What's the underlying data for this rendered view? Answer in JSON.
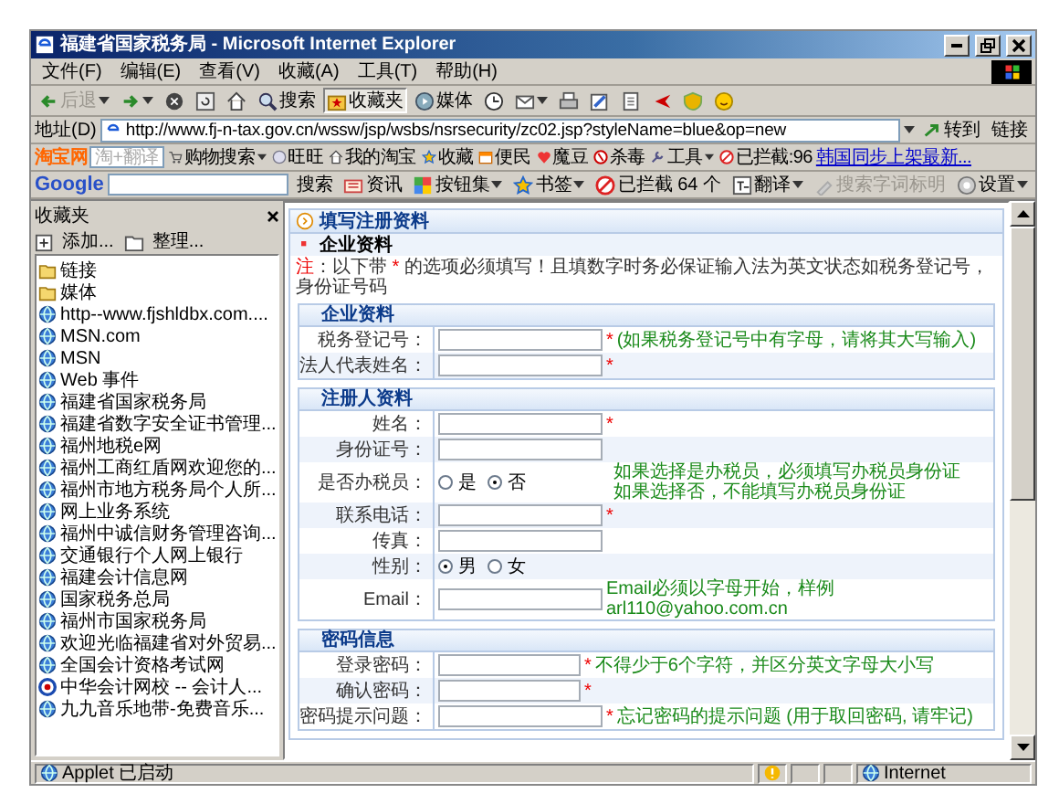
{
  "window": {
    "title": "福建省国家税务局 - Microsoft Internet Explorer"
  },
  "menu": [
    "文件(F)",
    "编辑(E)",
    "查看(V)",
    "收藏(A)",
    "工具(T)",
    "帮助(H)"
  ],
  "toolbar": [
    {
      "kind": "back",
      "label": "后退",
      "disabled": true,
      "dropdown": true
    },
    {
      "kind": "forward",
      "dropdown": true
    },
    {
      "kind": "stop"
    },
    {
      "kind": "refresh"
    },
    {
      "kind": "home"
    },
    {
      "kind": "search",
      "label": "搜索"
    },
    {
      "kind": "favorites",
      "label": "收藏夹",
      "selected": true
    },
    {
      "kind": "media",
      "label": "媒体"
    },
    {
      "kind": "history"
    },
    {
      "kind": "mail",
      "dropdown": true
    },
    {
      "kind": "print"
    },
    {
      "kind": "edit"
    },
    {
      "kind": "document"
    },
    {
      "kind": "arrow"
    },
    {
      "kind": "shield"
    },
    {
      "kind": "smiley"
    }
  ],
  "address": {
    "label": "地址(D)",
    "url": "http://www.fj-n-tax.gov.cn/wssw/jsp/wsbs/nsrsecurity/zc02.jsp?styleName=blue&op=new",
    "go": "转到",
    "links": "链接"
  },
  "taobao_bar": {
    "logo": "淘宝网",
    "placeholder": "淘+翻译",
    "items": [
      {
        "kind": "cart",
        "label": "购物搜索",
        "dropdown": true
      },
      {
        "kind": "chat",
        "label": "旺旺"
      },
      {
        "kind": "home",
        "label": "我的淘宝"
      },
      {
        "kind": "star",
        "label": "收藏"
      },
      {
        "kind": "calendar",
        "label": "便民"
      },
      {
        "kind": "heart",
        "label": "魔豆"
      },
      {
        "kind": "antivirus",
        "label": "杀毒"
      },
      {
        "kind": "tools",
        "label": "工具",
        "dropdown": true
      },
      {
        "kind": "block",
        "label": "已拦截:96"
      },
      {
        "kind": "link",
        "label": "韩国同步上架最新..."
      }
    ]
  },
  "google_bar": {
    "logo": "Google",
    "items": [
      {
        "kind": "plain",
        "label": "搜索"
      },
      {
        "kind": "news",
        "label": "资讯"
      },
      {
        "kind": "buttons",
        "label": "按钮集",
        "dropdown": true
      },
      {
        "kind": "star",
        "label": "书签",
        "dropdown": true
      },
      {
        "kind": "block",
        "label": "已拦截 64 个"
      },
      {
        "kind": "translate",
        "label": "翻译",
        "dropdown": true
      },
      {
        "kind": "highlight",
        "label": "搜索字词标明",
        "disabled": true
      },
      {
        "kind": "settings",
        "label": "设置",
        "dropdown": true
      }
    ]
  },
  "sidebar": {
    "title": "收藏夹",
    "add": "添加...",
    "organize": "整理...",
    "items": [
      {
        "kind": "folder",
        "label": "链接"
      },
      {
        "kind": "folder",
        "label": "媒体"
      },
      {
        "kind": "page",
        "label": "http--www.fjshldbx.com...."
      },
      {
        "kind": "page",
        "label": "MSN.com"
      },
      {
        "kind": "page",
        "label": "MSN"
      },
      {
        "kind": "page",
        "label": "Web 事件"
      },
      {
        "kind": "page",
        "label": "福建省国家税务局"
      },
      {
        "kind": "page",
        "label": "福建省数字安全证书管理..."
      },
      {
        "kind": "page",
        "label": "福州地税e网"
      },
      {
        "kind": "page",
        "label": "福州工商红盾网欢迎您的..."
      },
      {
        "kind": "page",
        "label": "福州市地方税务局个人所..."
      },
      {
        "kind": "page",
        "label": "网上业务系统"
      },
      {
        "kind": "page",
        "label": "福州中诚信财务管理咨询..."
      },
      {
        "kind": "page",
        "label": "交通银行个人网上银行"
      },
      {
        "kind": "page",
        "label": "福建会计信息网"
      },
      {
        "kind": "page",
        "label": "国家税务总局"
      },
      {
        "kind": "page",
        "label": "福州市国家税务局"
      },
      {
        "kind": "page",
        "label": "欢迎光临福建省对外贸易..."
      },
      {
        "kind": "page",
        "label": "全国会计资格考试网"
      },
      {
        "kind": "special",
        "label": "中华会计网校 -- 会计人..."
      },
      {
        "kind": "page",
        "label": "九九音乐地带-免费音乐..."
      }
    ]
  },
  "form": {
    "title": "填写注册资料",
    "subtitle": "企业资料",
    "note": [
      {
        "kind": "alert",
        "text": "注"
      },
      {
        "kind": "plain",
        "text": "：以下带 "
      },
      {
        "kind": "alert",
        "text": "*"
      },
      {
        "kind": "plain",
        "text": " 的选项必须填写！且填数字时务必保证输入法为英文状态如税务登记号，身份证号码"
      }
    ],
    "sections": [
      {
        "title": "企业资料",
        "rows": [
          {
            "kind": "text",
            "label": "税务登记号：",
            "mark": "*",
            "hints": [
              "(如果税务登记号中有字母，请将其大写输入)"
            ]
          },
          {
            "kind": "text",
            "label": "法人代表姓名：",
            "mark": "*"
          }
        ]
      },
      {
        "title": "注册人资料",
        "rows": [
          {
            "kind": "text",
            "label": "姓名：",
            "mark": "*"
          },
          {
            "kind": "text",
            "label": "身份证号："
          },
          {
            "kind": "radio",
            "label": "是否办税员：",
            "options": [
              {
                "label": "是",
                "selected": false
              },
              {
                "label": "否",
                "selected": true
              }
            ],
            "hints": [
              "如果选择是办税员，必须填写办税员身份证",
              "如果选择否，不能填写办税员身份证"
            ]
          },
          {
            "kind": "text",
            "label": "联系电话：",
            "mark": "*"
          },
          {
            "kind": "text",
            "label": "传真："
          },
          {
            "kind": "radio",
            "label": "性别：",
            "options": [
              {
                "label": "男",
                "selected": true
              },
              {
                "label": "女",
                "selected": false
              }
            ]
          },
          {
            "kind": "text",
            "label": "Email：",
            "hints": [
              "Email必须以字母开始，样例arl110@yahoo.com.cn"
            ]
          }
        ]
      },
      {
        "title": "密码信息",
        "rows": [
          {
            "kind": "password",
            "label": "登录密码：",
            "mark": "*",
            "hints": [
              "不得少于6个字符，并区分英文字母大小写"
            ]
          },
          {
            "kind": "password",
            "label": "确认密码：",
            "mark": "*"
          },
          {
            "kind": "text",
            "label": "密码提示问题：",
            "mark": "*",
            "hints": [
              "忘记密码的提示问题 (用于取回密码, 请牢记)"
            ]
          }
        ]
      }
    ]
  },
  "status_bar": {
    "text": "Applet 已启动",
    "zone": "Internet"
  }
}
